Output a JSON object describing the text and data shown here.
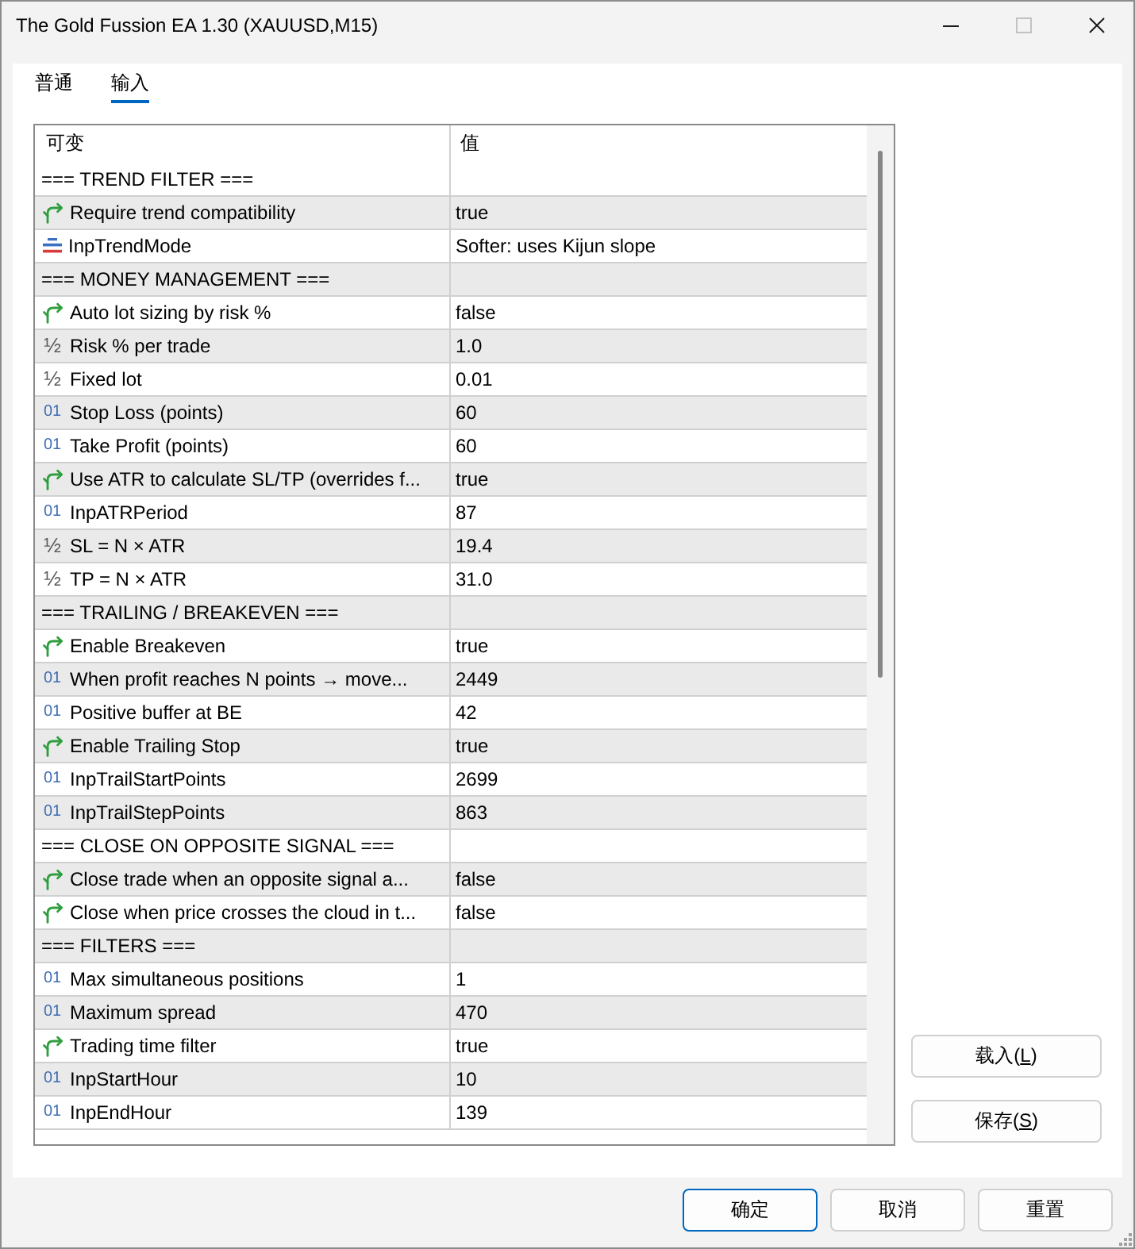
{
  "window": {
    "title": "The Gold Fussion EA 1.30 (XAUUSD,M15)",
    "controls": [
      {
        "kind": "minimize",
        "disabled": false
      },
      {
        "kind": "maximize",
        "disabled": true
      },
      {
        "kind": "close",
        "disabled": false
      }
    ]
  },
  "tabs": [
    {
      "label": "普通",
      "selected": false
    },
    {
      "label": "输入",
      "selected": true
    }
  ],
  "table": {
    "columns": [
      "可变",
      "值"
    ],
    "rows": [
      {
        "kind": "section",
        "name": "=== TREND FILTER ==="
      },
      {
        "kind": "bool",
        "name": "Require trend compatibility",
        "value": "true"
      },
      {
        "kind": "enum",
        "name": "InpTrendMode",
        "value": "Softer: uses Kijun slope"
      },
      {
        "kind": "section",
        "name": "=== MONEY MANAGEMENT ==="
      },
      {
        "kind": "bool",
        "name": "Auto lot sizing by risk %",
        "value": "false"
      },
      {
        "kind": "double",
        "type_label": "½",
        "name": "Risk % per trade",
        "value": "1.0"
      },
      {
        "kind": "double",
        "type_label": "½",
        "name": "Fixed lot",
        "value": "0.01"
      },
      {
        "kind": "int",
        "type_label": "01",
        "name": "Stop Loss (points)",
        "value": "60"
      },
      {
        "kind": "int",
        "type_label": "01",
        "name": "Take Profit (points)",
        "value": "60"
      },
      {
        "kind": "bool",
        "name": "Use ATR to calculate SL/TP (overrides f...",
        "value": "true"
      },
      {
        "kind": "int",
        "type_label": "01",
        "name": "InpATRPeriod",
        "value": "87"
      },
      {
        "kind": "double",
        "type_label": "½",
        "name": "SL = N × ATR",
        "value": "19.4"
      },
      {
        "kind": "double",
        "type_label": "½",
        "name": "TP = N × ATR",
        "value": "31.0"
      },
      {
        "kind": "section",
        "name": "=== TRAILING / BREAKEVEN ==="
      },
      {
        "kind": "bool",
        "name": "Enable Breakeven",
        "value": "true"
      },
      {
        "kind": "int",
        "type_label": "01",
        "name": "When profit reaches N points → move...",
        "value": "2449"
      },
      {
        "kind": "int",
        "type_label": "01",
        "name": "Positive buffer at BE",
        "value": "42"
      },
      {
        "kind": "bool",
        "name": "Enable Trailing Stop",
        "value": "true"
      },
      {
        "kind": "int",
        "type_label": "01",
        "name": "InpTrailStartPoints",
        "value": "2699"
      },
      {
        "kind": "int",
        "type_label": "01",
        "name": "InpTrailStepPoints",
        "value": "863"
      },
      {
        "kind": "section",
        "name": "=== CLOSE ON OPPOSITE SIGNAL ==="
      },
      {
        "kind": "bool",
        "name": "Close trade when an opposite signal a...",
        "value": "false"
      },
      {
        "kind": "bool",
        "name": "Close when price crosses the cloud in t...",
        "value": "false"
      },
      {
        "kind": "section",
        "name": "=== FILTERS ==="
      },
      {
        "kind": "int",
        "type_label": "01",
        "name": "Max simultaneous positions",
        "value": "1"
      },
      {
        "kind": "int",
        "type_label": "01",
        "name": "Maximum spread",
        "value": "470"
      },
      {
        "kind": "bool",
        "name": "Trading time filter",
        "value": "true"
      },
      {
        "kind": "int",
        "type_label": "01",
        "name": "InpStartHour",
        "value": "10"
      },
      {
        "kind": "int",
        "type_label": "01",
        "name": "InpEndHour",
        "value": "139"
      }
    ]
  },
  "side_buttons": [
    {
      "prefix": "载入(",
      "mnemonic": "L",
      "suffix": ")"
    },
    {
      "prefix": "保存(",
      "mnemonic": "S",
      "suffix": ")"
    }
  ],
  "dialog_buttons": [
    {
      "label": "确定",
      "default": true
    },
    {
      "label": "取消",
      "default": false
    },
    {
      "label": "重置",
      "default": false
    }
  ]
}
